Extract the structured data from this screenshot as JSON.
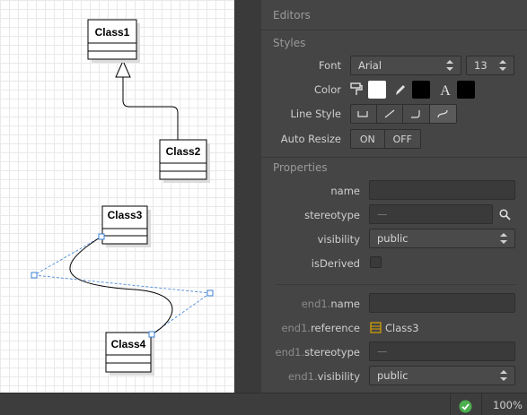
{
  "diagram": {
    "classes": [
      {
        "id": "c1",
        "name": "Class1"
      },
      {
        "id": "c2",
        "name": "Class2"
      },
      {
        "id": "c3",
        "name": "Class3"
      },
      {
        "id": "c4",
        "name": "Class4"
      }
    ]
  },
  "panel": {
    "editors_title": "Editors",
    "styles_title": "Styles",
    "font_label": "Font",
    "font_value": "Arial",
    "font_size": "13",
    "color_label": "Color",
    "colors": {
      "fill": "#ffffff",
      "line": "#000000",
      "font": "#000000"
    },
    "linestyle_label": "Line Style",
    "autoresize_label": "Auto Resize",
    "autoresize_on": "ON",
    "autoresize_off": "OFF",
    "properties_title": "Properties",
    "props": {
      "name_label": "name",
      "name_value": "",
      "stereotype_label": "stereotype",
      "stereotype_value": "—",
      "visibility_label": "visibility",
      "visibility_value": "public",
      "isderived_label": "isDerived",
      "end1_prefix": "end1.",
      "end1_name_label": "name",
      "end1_name_value": "",
      "end1_reference_label": "reference",
      "end1_reference_value": "Class3",
      "end1_stereotype_label": "stereotype",
      "end1_stereotype_value": "—",
      "end1_visibility_label": "visibility",
      "end1_visibility_value": "public"
    }
  },
  "statusbar": {
    "zoom": "100%",
    "status_icon": "check-circle-icon",
    "status_color": "#4caf50"
  }
}
